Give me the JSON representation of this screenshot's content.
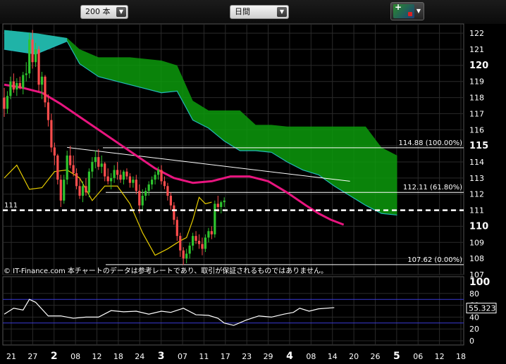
{
  "toolbar": {
    "period": "200 本",
    "span": "日間"
  },
  "copyright": "© IT-Finance.com  本チャートのデータは参考レートであり、取引が保証されるものではありません。",
  "colors": {
    "background": "#000000",
    "grid": "#2a2a2a",
    "cloud": "#0c9a0c",
    "cloud_upper": "#22b8b8",
    "up_candle": "#2ec42e",
    "down_candle": "#ff4d4d",
    "moving_average": "#e8157f",
    "yellow_line": "#e6cc00",
    "rsi_line": "#ffffff",
    "rsi_bands": "#3b3bd6"
  },
  "chart_data": [
    {
      "type": "candlestick",
      "x_tick_labels": [
        "21",
        "27",
        "2",
        "08",
        "12",
        "18",
        "24",
        "3",
        "07",
        "11",
        "17",
        "23",
        "29",
        "4",
        "08",
        "14",
        "20",
        "26",
        "5",
        "06",
        "12",
        "18"
      ],
      "x_major_ticks": [
        "2",
        "3",
        "4",
        "5"
      ],
      "ylim": [
        107,
        122.4
      ],
      "y_ticks": [
        107,
        108,
        109,
        110,
        111,
        112,
        113,
        114,
        115,
        116,
        117,
        118,
        119,
        120,
        121,
        122
      ],
      "y_major_ticks": [
        110,
        115,
        120
      ],
      "current_price_label": "111",
      "current_price": 111,
      "fib_levels": [
        {
          "label": "114.88 (100.00%)",
          "value": 114.88
        },
        {
          "label": "112.11 (61.80%)",
          "value": 112.11
        },
        {
          "label": "107.62 (0.00%)",
          "value": 107.62
        }
      ],
      "candles": [
        [
          118.0,
          118.6,
          116.8,
          117.3
        ],
        [
          117.3,
          118.4,
          117.0,
          118.1
        ],
        [
          118.1,
          119.3,
          117.9,
          119.0
        ],
        [
          119.0,
          119.5,
          118.3,
          118.5
        ],
        [
          118.5,
          119.2,
          118.1,
          118.9
        ],
        [
          118.9,
          119.3,
          118.5,
          118.6
        ],
        [
          118.6,
          119.6,
          118.2,
          119.4
        ],
        [
          119.4,
          120.2,
          119.0,
          119.5
        ],
        [
          119.5,
          122.0,
          119.2,
          121.6
        ],
        [
          121.6,
          122.2,
          119.8,
          120.2
        ],
        [
          120.2,
          121.4,
          119.9,
          121.0
        ],
        [
          121.0,
          121.2,
          118.4,
          118.8
        ],
        [
          118.8,
          119.6,
          117.9,
          119.3
        ],
        [
          119.3,
          119.4,
          117.4,
          117.7
        ],
        [
          117.7,
          118.2,
          116.2,
          116.6
        ],
        [
          116.6,
          117.0,
          114.6,
          114.9
        ],
        [
          114.9,
          115.2,
          113.8,
          114.4
        ],
        [
          114.4,
          114.5,
          112.6,
          112.9
        ],
        [
          112.9,
          113.2,
          111.2,
          111.6
        ],
        [
          111.6,
          113.2,
          111.4,
          112.9
        ],
        [
          112.9,
          114.7,
          112.6,
          114.4
        ],
        [
          114.4,
          115.0,
          113.6,
          113.8
        ],
        [
          113.8,
          114.4,
          113.1,
          113.3
        ],
        [
          113.3,
          113.6,
          112.3,
          112.5
        ],
        [
          112.5,
          113.0,
          111.7,
          111.9
        ],
        [
          111.9,
          112.8,
          111.5,
          112.5
        ],
        [
          112.5,
          113.0,
          111.9,
          112.1
        ],
        [
          112.1,
          113.6,
          111.8,
          113.4
        ],
        [
          113.4,
          114.3,
          113.0,
          114.0
        ],
        [
          114.0,
          114.7,
          113.6,
          114.3
        ],
        [
          114.3,
          114.8,
          113.5,
          113.7
        ],
        [
          113.7,
          114.4,
          113.3,
          113.9
        ],
        [
          113.9,
          114.0,
          112.8,
          113.1
        ],
        [
          113.1,
          113.6,
          112.6,
          112.8
        ],
        [
          112.8,
          113.3,
          112.3,
          113.0
        ],
        [
          113.0,
          113.8,
          112.7,
          113.5
        ],
        [
          113.5,
          114.0,
          112.9,
          113.2
        ],
        [
          113.2,
          113.5,
          112.7,
          112.9
        ],
        [
          112.9,
          113.5,
          112.6,
          113.4
        ],
        [
          113.4,
          113.6,
          112.9,
          113.1
        ],
        [
          113.1,
          113.3,
          112.4,
          112.7
        ],
        [
          112.7,
          113.1,
          112.4,
          112.9
        ],
        [
          112.9,
          113.2,
          112.0,
          112.2
        ],
        [
          112.2,
          112.6,
          110.8,
          111.3
        ],
        [
          111.3,
          112.3,
          111.0,
          111.9
        ],
        [
          111.9,
          112.4,
          111.6,
          112.2
        ],
        [
          112.2,
          112.8,
          111.9,
          112.6
        ],
        [
          112.6,
          113.1,
          112.3,
          112.9
        ],
        [
          112.9,
          113.4,
          112.6,
          113.2
        ],
        [
          113.2,
          113.7,
          112.9,
          113.5
        ],
        [
          113.5,
          113.8,
          112.6,
          112.8
        ],
        [
          112.8,
          113.1,
          112.3,
          112.5
        ],
        [
          112.5,
          112.7,
          111.6,
          111.9
        ],
        [
          111.9,
          112.1,
          111.0,
          111.3
        ],
        [
          111.3,
          111.5,
          110.1,
          110.4
        ],
        [
          110.4,
          110.6,
          109.1,
          109.4
        ],
        [
          109.4,
          109.6,
          108.1,
          108.5
        ],
        [
          108.5,
          108.7,
          107.6,
          108.0
        ],
        [
          108.0,
          108.6,
          107.7,
          108.3
        ],
        [
          108.3,
          109.0,
          108.0,
          108.8
        ],
        [
          108.8,
          109.6,
          108.5,
          109.4
        ],
        [
          109.4,
          109.7,
          108.9,
          109.1
        ],
        [
          109.1,
          109.5,
          108.6,
          108.9
        ],
        [
          108.9,
          109.3,
          108.2,
          108.6
        ],
        [
          108.6,
          109.5,
          108.4,
          109.3
        ],
        [
          109.3,
          109.9,
          109.0,
          109.7
        ],
        [
          109.7,
          110.0,
          109.2,
          109.5
        ],
        [
          109.5,
          111.6,
          109.3,
          111.4
        ],
        [
          111.4,
          111.9,
          110.9,
          111.2
        ],
        [
          111.2,
          111.6,
          110.8,
          111.5
        ],
        [
          111.5,
          111.8,
          111.2,
          111.6
        ]
      ],
      "moving_average": [
        {
          "x": 0,
          "y": 118.8
        },
        {
          "x": 6,
          "y": 118.6
        },
        {
          "x": 12,
          "y": 118.3
        },
        {
          "x": 18,
          "y": 117.6
        },
        {
          "x": 24,
          "y": 116.8
        },
        {
          "x": 30,
          "y": 116.0
        },
        {
          "x": 36,
          "y": 115.2
        },
        {
          "x": 42,
          "y": 114.4
        },
        {
          "x": 48,
          "y": 113.6
        },
        {
          "x": 54,
          "y": 113.0
        },
        {
          "x": 60,
          "y": 112.7
        },
        {
          "x": 66,
          "y": 112.8
        },
        {
          "x": 72,
          "y": 113.1
        },
        {
          "x": 78,
          "y": 113.1
        },
        {
          "x": 84,
          "y": 112.8
        },
        {
          "x": 90,
          "y": 112.1
        },
        {
          "x": 96,
          "y": 111.3
        },
        {
          "x": 100,
          "y": 110.8
        },
        {
          "x": 104,
          "y": 110.4
        },
        {
          "x": 108,
          "y": 110.1
        }
      ],
      "yellow_line": [
        {
          "x": 0,
          "y": 113.0
        },
        {
          "x": 4,
          "y": 113.8
        },
        {
          "x": 8,
          "y": 112.3
        },
        {
          "x": 12,
          "y": 112.4
        },
        {
          "x": 16,
          "y": 113.4
        },
        {
          "x": 20,
          "y": 113.5
        },
        {
          "x": 24,
          "y": 113.0
        },
        {
          "x": 28,
          "y": 111.6
        },
        {
          "x": 32,
          "y": 112.5
        },
        {
          "x": 36,
          "y": 112.5
        },
        {
          "x": 40,
          "y": 111.4
        },
        {
          "x": 44,
          "y": 109.6
        },
        {
          "x": 48,
          "y": 108.2
        },
        {
          "x": 52,
          "y": 108.6
        },
        {
          "x": 56,
          "y": 109.1
        },
        {
          "x": 58,
          "y": 109.3
        },
        {
          "x": 60,
          "y": 110.4
        },
        {
          "x": 62,
          "y": 111.8
        },
        {
          "x": 64,
          "y": 111.4
        },
        {
          "x": 66,
          "y": 111.5
        }
      ],
      "trendline": {
        "from": {
          "x": 20,
          "y": 114.9
        },
        "to": {
          "x": 110,
          "y": 112.8
        }
      },
      "cloud": [
        {
          "x": 0,
          "y1": 122.2,
          "y2": 121.0
        },
        {
          "x": 10,
          "y1": 122.0,
          "y2": 120.7
        },
        {
          "x": 20,
          "y1": 121.7,
          "y2": 121.5
        },
        {
          "x": 24,
          "y1": 121.0,
          "y2": 120.1
        },
        {
          "x": 30,
          "y1": 120.5,
          "y2": 119.3
        },
        {
          "x": 40,
          "y1": 120.5,
          "y2": 118.8
        },
        {
          "x": 50,
          "y1": 120.3,
          "y2": 118.3
        },
        {
          "x": 55,
          "y1": 120.0,
          "y2": 118.4
        },
        {
          "x": 60,
          "y1": 117.8,
          "y2": 116.6
        },
        {
          "x": 65,
          "y1": 117.2,
          "y2": 116.1
        },
        {
          "x": 70,
          "y1": 117.2,
          "y2": 115.3
        },
        {
          "x": 75,
          "y1": 117.2,
          "y2": 114.7
        },
        {
          "x": 80,
          "y1": 116.3,
          "y2": 114.7
        },
        {
          "x": 85,
          "y1": 116.3,
          "y2": 114.6
        },
        {
          "x": 90,
          "y1": 116.2,
          "y2": 114.0
        },
        {
          "x": 95,
          "y1": 116.2,
          "y2": 113.5
        },
        {
          "x": 100,
          "y1": 116.2,
          "y2": 113.2
        },
        {
          "x": 105,
          "y1": 116.2,
          "y2": 112.5
        },
        {
          "x": 110,
          "y1": 116.2,
          "y2": 111.9
        },
        {
          "x": 115,
          "y1": 116.2,
          "y2": 111.3
        },
        {
          "x": 120,
          "y1": 114.9,
          "y2": 110.8
        },
        {
          "x": 125,
          "y1": 114.4,
          "y2": 110.7
        }
      ]
    },
    {
      "type": "line",
      "ylim": [
        0,
        100
      ],
      "y_ticks": [
        0,
        20,
        40,
        60,
        80
      ],
      "y_major_ticks": [
        100
      ],
      "bands": [
        30,
        70
      ],
      "current_value_label": "55.323",
      "current_value": 55.323,
      "values": [
        {
          "x": 0,
          "y": 45
        },
        {
          "x": 3,
          "y": 55
        },
        {
          "x": 6,
          "y": 52
        },
        {
          "x": 8,
          "y": 70
        },
        {
          "x": 10,
          "y": 65
        },
        {
          "x": 14,
          "y": 42
        },
        {
          "x": 18,
          "y": 42
        },
        {
          "x": 22,
          "y": 38
        },
        {
          "x": 26,
          "y": 40
        },
        {
          "x": 30,
          "y": 40
        },
        {
          "x": 34,
          "y": 51
        },
        {
          "x": 38,
          "y": 49
        },
        {
          "x": 42,
          "y": 50
        },
        {
          "x": 46,
          "y": 45
        },
        {
          "x": 50,
          "y": 50
        },
        {
          "x": 53,
          "y": 48
        },
        {
          "x": 57,
          "y": 55
        },
        {
          "x": 61,
          "y": 44
        },
        {
          "x": 65,
          "y": 43
        },
        {
          "x": 68,
          "y": 38
        },
        {
          "x": 70,
          "y": 30
        },
        {
          "x": 73,
          "y": 26
        },
        {
          "x": 77,
          "y": 35
        },
        {
          "x": 81,
          "y": 42
        },
        {
          "x": 85,
          "y": 40
        },
        {
          "x": 89,
          "y": 45
        },
        {
          "x": 92,
          "y": 48
        },
        {
          "x": 94,
          "y": 55
        },
        {
          "x": 97,
          "y": 50
        },
        {
          "x": 100,
          "y": 54
        },
        {
          "x": 105,
          "y": 56
        }
      ]
    }
  ]
}
